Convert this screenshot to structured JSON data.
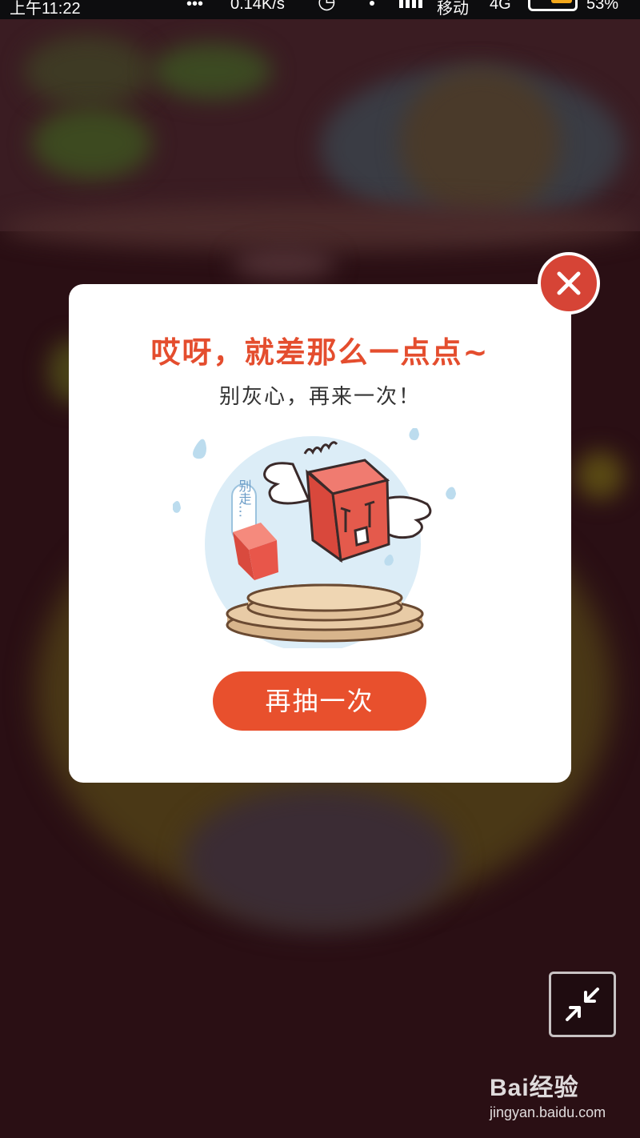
{
  "status_bar": {
    "time": "上午11:22",
    "dots": "•••",
    "network_speed": "0.14K/s",
    "carrier": "移动",
    "network_type": "4G",
    "battery": "53%",
    "icons": [
      "alarm-icon",
      "wifi-icon",
      "signal-icon",
      "battery-icon"
    ]
  },
  "modal": {
    "title": "哎呀，就差那么一点点~",
    "subtitle": "别灰心，再来一次！",
    "illustration_tag": "别走…",
    "retry_label": "再抽一次",
    "close_icon": "close-icon"
  },
  "minimize_icon": "minimize-arrows-icon",
  "watermark": {
    "brand": "Bai经验",
    "url": "jingyan.baidu.com"
  },
  "colors": {
    "accent": "#e44d2e",
    "button": "#e8502d",
    "close": "#d64436",
    "backdrop": "#2a0f14"
  }
}
